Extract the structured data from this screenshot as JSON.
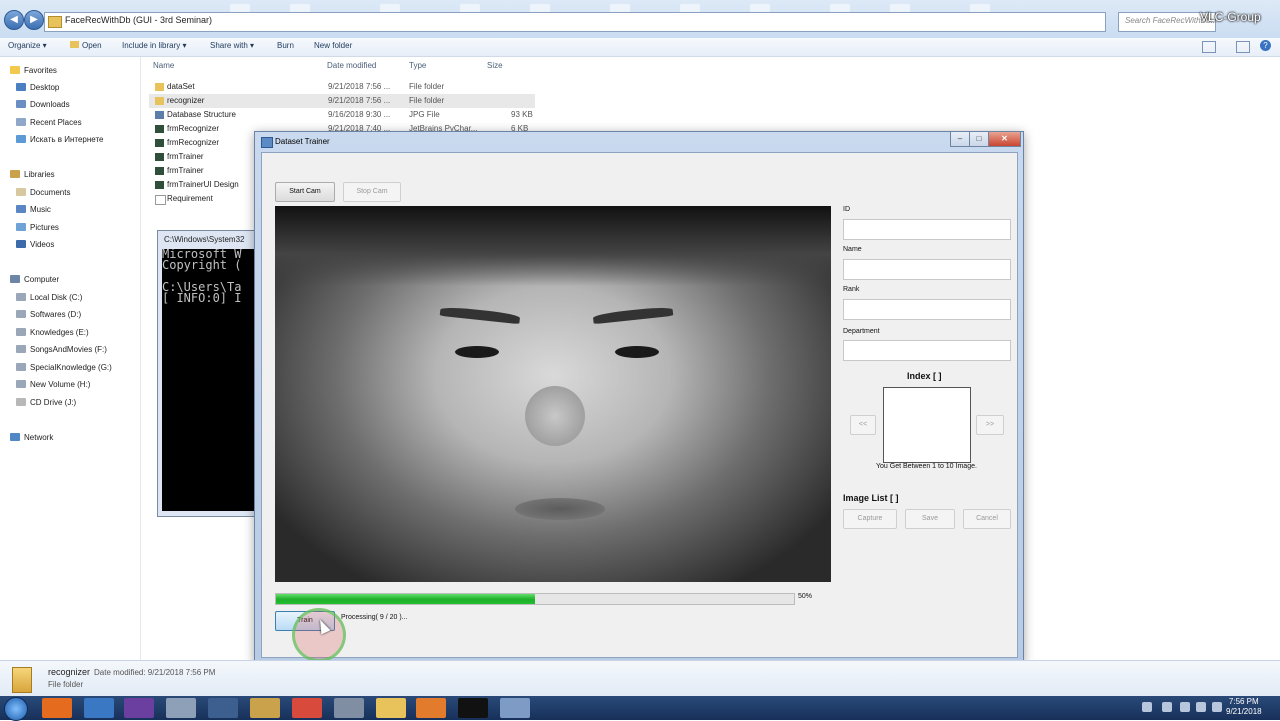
{
  "explorer": {
    "address_path": "FaceRecWithDb (GUI - 3rd Seminar)",
    "search_placeholder": "Search FaceRecWithDb...",
    "toolbar": {
      "organize": "Organize ▾",
      "open": "Open",
      "include": "Include in library ▾",
      "share": "Share with ▾",
      "burn": "Burn",
      "new_folder": "New folder"
    },
    "nav": {
      "favorites": "Favorites",
      "desktop": "Desktop",
      "downloads": "Downloads",
      "recent": "Recent Places",
      "search_web": "Искать в Интернете",
      "libraries": "Libraries",
      "documents": "Documents",
      "music": "Music",
      "pictures": "Pictures",
      "videos": "Videos",
      "computer": "Computer",
      "drives": [
        "Local Disk (C:)",
        "Softwares (D:)",
        "Knowledges (E:)",
        "SongsAndMovies (F:)",
        "SpecialKnowledge (G:)",
        "New Volume (H:)",
        "CD Drive (J:)"
      ],
      "network": "Network"
    },
    "columns": {
      "name": "Name",
      "date": "Date modified",
      "type": "Type",
      "size": "Size"
    },
    "files": [
      {
        "name": "dataSet",
        "date": "9/21/2018 7:56 ...",
        "type": "File folder",
        "size": ""
      },
      {
        "name": "recognizer",
        "date": "9/21/2018 7:56 ...",
        "type": "File folder",
        "size": ""
      },
      {
        "name": "Database Structure",
        "date": "9/16/2018 9:30 ...",
        "type": "JPG File",
        "size": "93 KB"
      },
      {
        "name": "frmRecognizer",
        "date": "9/21/2018 7:40 ...",
        "type": "JetBrains PyChar...",
        "size": "6 KB"
      },
      {
        "name": "frmRecognizer",
        "date": "",
        "type": "",
        "size": ""
      },
      {
        "name": "frmTrainer",
        "date": "",
        "type": "",
        "size": ""
      },
      {
        "name": "frmTrainer",
        "date": "",
        "type": "",
        "size": ""
      },
      {
        "name": "frmTrainerUI Design",
        "date": "",
        "type": "",
        "size": ""
      },
      {
        "name": "Requirement",
        "date": "",
        "type": "",
        "size": ""
      }
    ],
    "details": {
      "name": "recognizer",
      "modified": "Date modified: 9/21/2018 7:56 PM",
      "type": "File folder"
    }
  },
  "console": {
    "title": "C:\\Windows\\System32",
    "lines": "Microsoft W\nCopyright (\n\nC:\\Users\\Ta\n[ INFO:0] I"
  },
  "watermark": "VLC-Group",
  "trainer": {
    "title": "Dataset Trainer",
    "start_cam": "Start Cam",
    "stop_cam": "Stop Cam",
    "id_label": "ID",
    "name_label": "Name",
    "rank_label": "Rank",
    "department_label": "Department",
    "index_title": "Index [ ]",
    "prev": "<<",
    "next": ">>",
    "index_hint": "You Get Between 1 to 10 Image.",
    "image_list_title": "Image List [ ]",
    "capture": "Capture",
    "save": "Save",
    "cancel": "Cancel",
    "progress_percent": 50,
    "progress_label": "50%",
    "train": "Train",
    "status": "Processing( 9 / 20 )..."
  },
  "taskbar": {
    "time": "7:56 PM",
    "date": "9/21/2018"
  }
}
